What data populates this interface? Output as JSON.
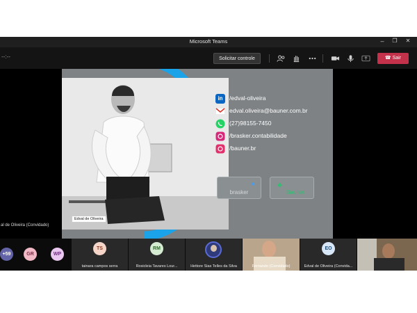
{
  "window": {
    "title": "Microsoft Teams",
    "minimize": "–",
    "maximize": "❐",
    "close": "✕"
  },
  "toolbar": {
    "timer": "--:--",
    "request_control": "Solicitar controle",
    "leave": "Sair",
    "icons": [
      "people-icon",
      "raise-hand-icon",
      "more-icon",
      "camera-icon",
      "mic-icon",
      "share-icon",
      "phone-icon"
    ]
  },
  "stage": {
    "left_participant": "al de Oliveira (Convidado)",
    "slide": {
      "photo_caption": "Edval de Oliveira",
      "contacts": [
        {
          "icon": "linkedin-icon",
          "text": "/edval-oliveira"
        },
        {
          "icon": "email-icon",
          "text": "edval.oliveira@bauner.com.br"
        },
        {
          "icon": "whatsapp-icon",
          "text": "(27)98155-7450"
        },
        {
          "icon": "instagram-icon",
          "text": "/brasker.contabilidade"
        },
        {
          "icon": "instagram-icon",
          "text": "/bauner.br"
        }
      ],
      "brands": [
        "brasker",
        "Bauner"
      ],
      "colors": {
        "accent_ring": "#1aa3e8",
        "slide_bg": "#7e8285",
        "brasker_blue": "#3aa0ff",
        "bauner_green": "#2fbf71"
      }
    }
  },
  "strip": {
    "overflow_count": "+59",
    "avatars": [
      {
        "initials": "GR",
        "color": "#f2b8c6"
      },
      {
        "initials": "WP",
        "color": "#e9c7f0"
      }
    ],
    "tiles": [
      {
        "initials": "TS",
        "name": "tainara campos serra",
        "color": "#f5d5c8",
        "muted": true
      },
      {
        "initials": "RM",
        "name": "Rosicleia Tavares Lour...",
        "color": "#d6ecd2",
        "muted": true
      },
      {
        "initials": "",
        "name": "Hettore Sias Telles da Silva",
        "muted": false
      },
      {
        "initials": "",
        "name": "Fernando (Convidado)",
        "muted": false
      },
      {
        "initials": "EO",
        "name": "Edval de Oliveira (Convida...",
        "color": "#d7e7f7",
        "muted": false
      },
      {
        "initials": "",
        "name": "",
        "muted": false
      }
    ]
  }
}
